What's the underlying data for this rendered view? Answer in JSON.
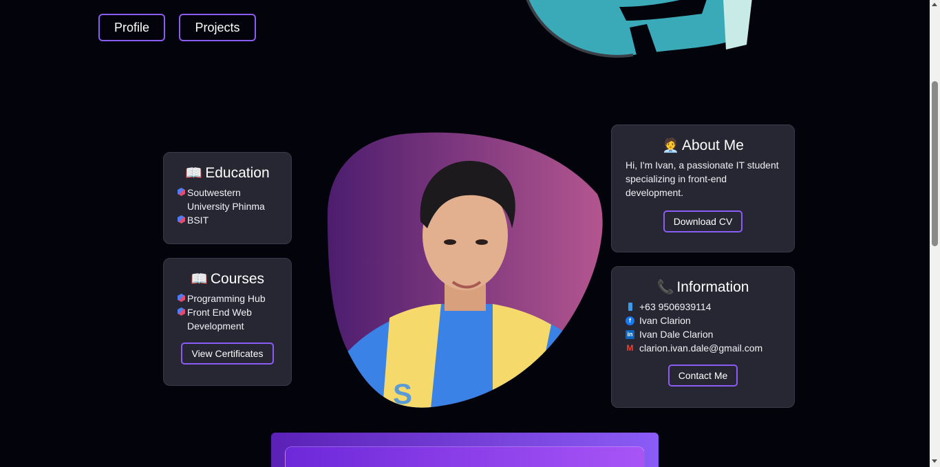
{
  "nav": {
    "profile_label": "Profile",
    "projects_label": "Projects"
  },
  "education": {
    "icon": "book-emoji",
    "title": "Education",
    "items": [
      "Soutwestern University Phinma",
      "BSIT"
    ]
  },
  "courses": {
    "icon": "book-emoji",
    "title": "Courses",
    "items": [
      "Programming Hub",
      "Front End Web Development"
    ],
    "button_label": "View Certificates"
  },
  "about": {
    "icon": "person-emoji",
    "title": "About Me",
    "text": "Hi, I'm Ivan, a passionate IT student specializing in front-end development.",
    "button_label": "Download CV"
  },
  "information": {
    "icon": "phone-emoji",
    "title": "Information",
    "phone": "+63 9506939114",
    "facebook": "Ivan Clarion",
    "linkedin": "Ivan Dale Clarion",
    "email": "clarion.ivan.dale@gmail.com",
    "button_label": "Contact Me"
  },
  "colors": {
    "accent": "#8b5cf6",
    "card_bg": "#262733",
    "page_bg": "#03040b",
    "blob_start": "#4c1d6e",
    "blob_end": "#b4568f"
  }
}
